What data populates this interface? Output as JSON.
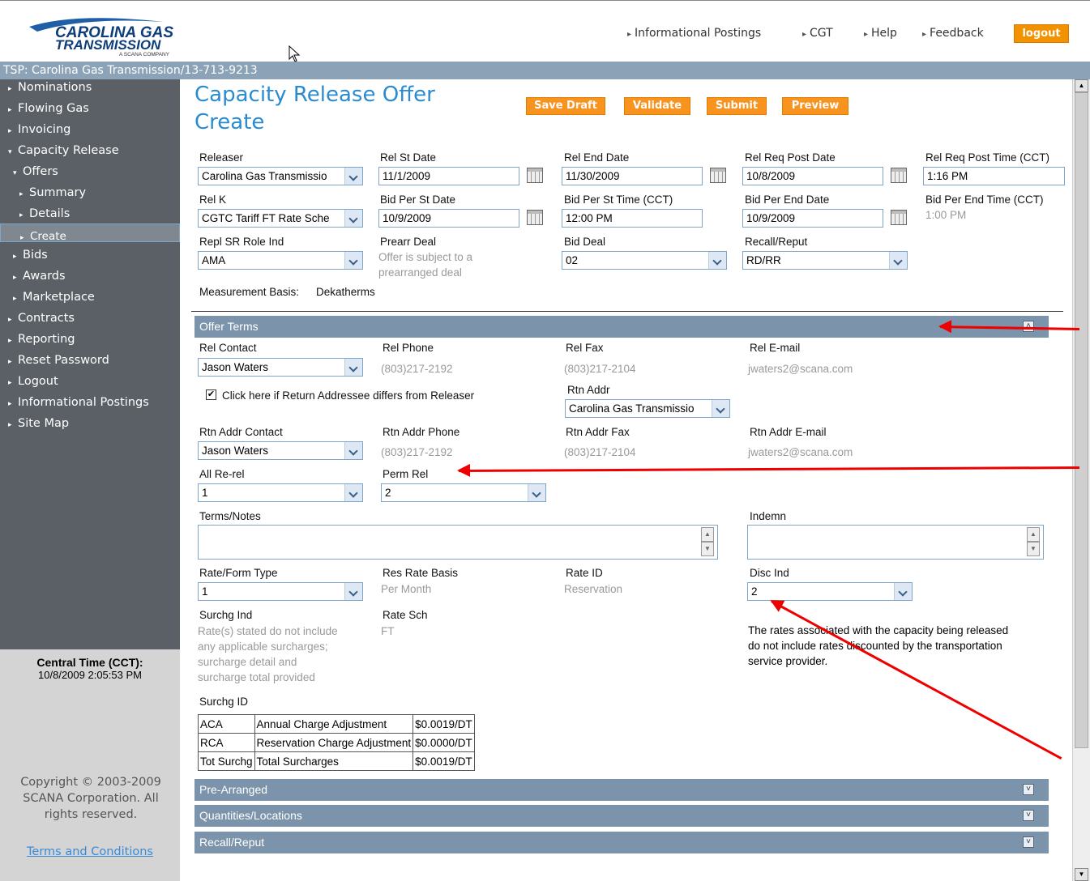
{
  "header": {
    "logo_line1": "CAROLINA GAS",
    "logo_line2": "TRANSMISSION",
    "logo_sub": "A SCANA COMPANY",
    "links": [
      "Informational Postings",
      "CGT",
      "Help",
      "Feedback"
    ],
    "logout": "logout"
  },
  "tsp": "TSP: Carolina Gas Transmission/13-713-9213",
  "nav": {
    "items": [
      "Nominations",
      "Flowing Gas",
      "Invoicing",
      "Capacity Release",
      "Offers",
      "Summary",
      "Details",
      "Create",
      "Bids",
      "Awards",
      "Marketplace",
      "Contracts",
      "Reporting",
      "Reset Password",
      "Logout",
      "Informational Postings",
      "Site Map"
    ]
  },
  "clock": {
    "label": "Central Time (CCT):",
    "value": "10/8/2009 2:05:53 PM"
  },
  "copyright": "Copyright © 2003-2009 SCANA Corporation. All rights reserved.",
  "terms_link": "Terms and Conditions",
  "page": {
    "title_line1": "Capacity Release Offer",
    "title_line2": "Create",
    "buttons": [
      "Save Draft",
      "Validate",
      "Submit",
      "Preview"
    ]
  },
  "form": {
    "releaser": {
      "label": "Releaser",
      "value": "Carolina Gas Transmissio"
    },
    "rel_st_date": {
      "label": "Rel St Date",
      "value": "11/1/2009"
    },
    "rel_end_date": {
      "label": "Rel End Date",
      "value": "11/30/2009"
    },
    "rel_req_post_date": {
      "label": "Rel Req Post Date",
      "value": "10/8/2009"
    },
    "rel_req_post_time": {
      "label": "Rel Req Post Time (CCT)",
      "value": "1:16 PM"
    },
    "rel_k": {
      "label": "Rel K",
      "value": "CGTC Tariff FT Rate Sche"
    },
    "bid_per_st_date": {
      "label": "Bid Per St Date",
      "value": "10/9/2009"
    },
    "bid_per_st_time": {
      "label": "Bid Per St Time (CCT)",
      "value": "12:00 PM"
    },
    "bid_per_end_date": {
      "label": "Bid Per End Date",
      "value": "10/9/2009"
    },
    "bid_per_end_time": {
      "label": "Bid Per End Time (CCT)",
      "value": "1:00 PM"
    },
    "repl_sr_role": {
      "label": "Repl SR Role Ind",
      "value": "AMA"
    },
    "prearr_deal": {
      "label": "Prearr Deal",
      "value_line1": "Offer is subject to a",
      "value_line2": "prearranged deal"
    },
    "bid_deal": {
      "label": "Bid Deal",
      "value": "02"
    },
    "recall_reput": {
      "label": "Recall/Reput",
      "value": "RD/RR"
    },
    "measurement_label": "Measurement Basis:",
    "measurement_value": "Dekatherms"
  },
  "offer_terms": {
    "title": "Offer Terms",
    "rel_contact": {
      "label": "Rel Contact",
      "value": "Jason Waters"
    },
    "rel_phone": {
      "label": "Rel Phone",
      "value": "(803)217-2192"
    },
    "rel_fax": {
      "label": "Rel Fax",
      "value": "(803)217-2104"
    },
    "rel_email": {
      "label": "Rel E-mail",
      "value": "jwaters2@scana.com"
    },
    "return_checkbox": "Click here if Return Addressee differs from Releaser",
    "rtn_addr": {
      "label": "Rtn Addr",
      "value": "Carolina Gas Transmissio"
    },
    "rtn_contact": {
      "label": "Rtn Addr Contact",
      "value": "Jason Waters"
    },
    "rtn_phone": {
      "label": "Rtn Addr Phone",
      "value": "(803)217-2192"
    },
    "rtn_fax": {
      "label": "Rtn Addr Fax",
      "value": "(803)217-2104"
    },
    "rtn_email": {
      "label": "Rtn Addr E-mail",
      "value": "jwaters2@scana.com"
    },
    "all_rerel": {
      "label": "All Re-rel",
      "value": "1"
    },
    "perm_rel": {
      "label": "Perm Rel",
      "value": "2"
    },
    "terms_notes": {
      "label": "Terms/Notes"
    },
    "indemn": {
      "label": "Indemn"
    },
    "rate_form": {
      "label": "Rate/Form Type",
      "value": "1"
    },
    "res_rate_basis": {
      "label": "Res Rate Basis",
      "value": "Per Month"
    },
    "rate_id": {
      "label": "Rate ID",
      "value": "Reservation"
    },
    "disc_ind": {
      "label": "Disc Ind",
      "value": "2"
    },
    "surchg_ind": {
      "label": "Surchg Ind",
      "lines": [
        "Rate(s) stated do not include",
        "any applicable surcharges;",
        "surcharge detail and",
        "surcharge total provided"
      ]
    },
    "rate_sch": {
      "label": "Rate Sch",
      "value": "FT"
    },
    "disc_note": [
      "The rates associated with the capacity being released",
      "do not include rates discounted by the transportation",
      "service provider."
    ],
    "surchg_id_label": "Surchg ID",
    "surcharges": [
      [
        "ACA",
        "Annual Charge Adjustment",
        "$0.0019/DT"
      ],
      [
        "RCA",
        "Reservation Charge Adjustment",
        "$0.0000/DT"
      ],
      [
        "Tot Surchg",
        "Total Surcharges",
        "$0.0019/DT"
      ]
    ]
  },
  "collapsed_sections": [
    "Pre-Arranged",
    "Quantities/Locations",
    "Recall/Reput"
  ],
  "colors": {
    "accent": "#f7931e",
    "title": "#2a8bd0",
    "section": "#7c94ab",
    "nav": "#5a6066",
    "annotation": "#e00000"
  }
}
